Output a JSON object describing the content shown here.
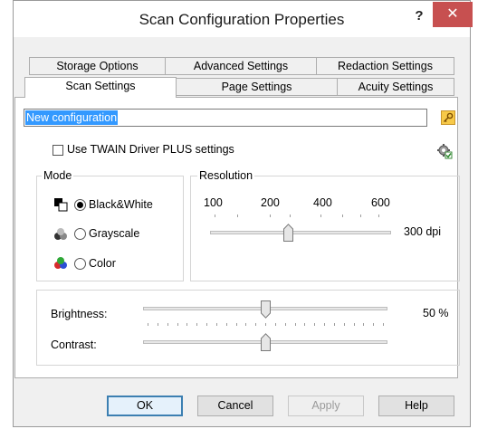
{
  "window": {
    "title": "Scan Configuration Properties",
    "help_label": "?",
    "close_label": "✕"
  },
  "tabs": {
    "row1": [
      "Storage Options",
      "Advanced Settings",
      "Redaction Settings"
    ],
    "row2": [
      "Scan Settings",
      "Page Settings",
      "Acuity Settings"
    ],
    "active": "Scan Settings"
  },
  "config_name": {
    "value": "New configuration",
    "key_icon": "key-icon"
  },
  "twain": {
    "label": "Use TWAIN Driver PLUS settings",
    "checked": false,
    "gear_icon": "gear-icon"
  },
  "mode": {
    "title": "Mode",
    "options": [
      {
        "label": "Black&White",
        "selected": true,
        "icon": "black-white-icon"
      },
      {
        "label": "Grayscale",
        "selected": false,
        "icon": "grayscale-icon"
      },
      {
        "label": "Color",
        "selected": false,
        "icon": "color-icon"
      }
    ]
  },
  "resolution": {
    "title": "Resolution",
    "ticks": [
      "100",
      "200",
      "400",
      "600"
    ],
    "value": "300 dpi",
    "position_fraction": 0.43
  },
  "brightness": {
    "label": "Brightness:",
    "value": "50 %",
    "position_fraction": 0.5
  },
  "contrast": {
    "label": "Contrast:",
    "position_fraction": 0.5
  },
  "buttons": {
    "ok": "OK",
    "cancel": "Cancel",
    "apply": "Apply",
    "help": "Help"
  },
  "colors": {
    "close_button": "#c75050",
    "selection": "#3399ff",
    "default_button_border": "#3c7fb1"
  }
}
